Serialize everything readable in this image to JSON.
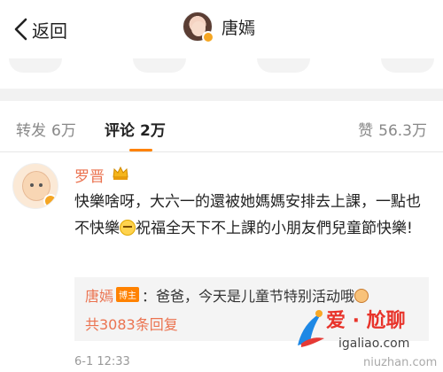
{
  "navbar": {
    "back_label": "返回",
    "title": "唐嫣"
  },
  "tabs": {
    "repost_label": "转发",
    "repost_count": "6万",
    "comment_label": "评论",
    "comment_count": "2万",
    "like_label": "赞",
    "like_count": "56.3万"
  },
  "comment": {
    "author": "罗晋",
    "text_part1": "快樂啥呀，大六一的還被她媽媽安排去上課，一點也不快樂",
    "text_part2": "祝福全天下不上課的小朋友們兒童節快樂!",
    "time": "6-1 12:33",
    "reply": {
      "author": "唐嫣",
      "tag": "博主",
      "text": "：爸爸，今天是儿童节特别活动哦",
      "more_label": "共3083条回复"
    }
  },
  "watermark": {
    "brand": "爱 · 尬聊",
    "url": "igaliao.com",
    "url2": "niuzhan.com"
  },
  "colors": {
    "accent": "#ff8200",
    "name": "#eb7350",
    "text": "#222222",
    "muted": "#888888"
  }
}
